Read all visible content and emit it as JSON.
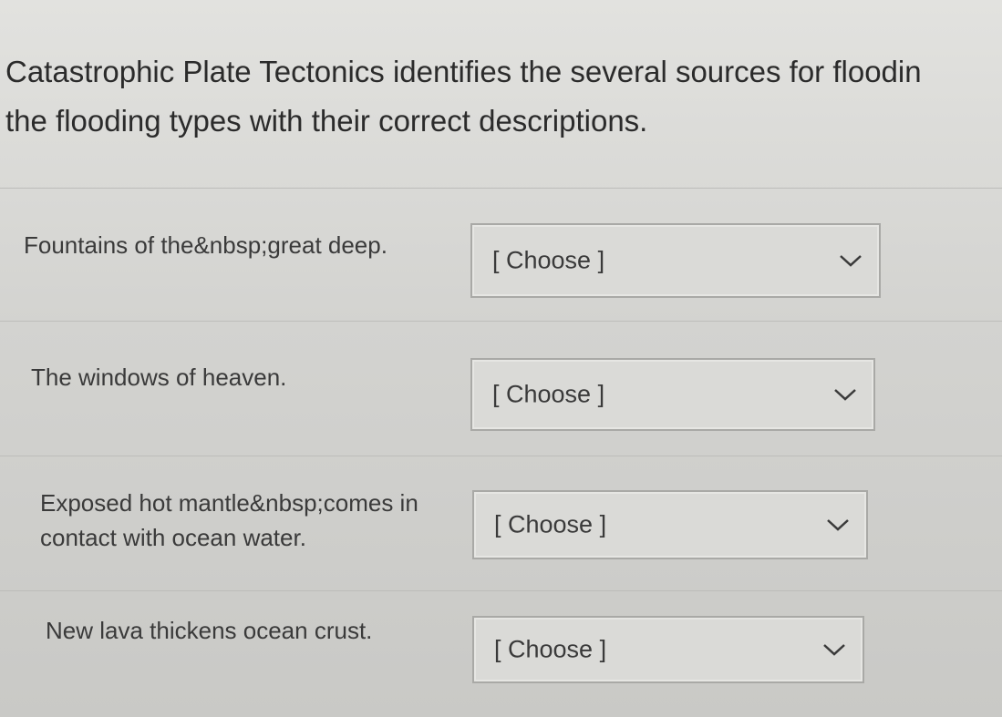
{
  "question": {
    "line1": "Catastrophic Plate Tectonics identifies the several sources for floodin",
    "line2": "the flooding types with their correct descriptions."
  },
  "matching": [
    {
      "prompt": "Fountains of the&nbsp;great deep.",
      "selected": "[ Choose ]"
    },
    {
      "prompt": "The windows of heaven.",
      "selected": "[ Choose ]"
    },
    {
      "prompt_line1": "Exposed hot mantle&nbsp;comes in",
      "prompt_line2": "contact with ocean water.",
      "selected": "[ Choose ]"
    },
    {
      "prompt": "New lava thickens ocean crust.",
      "selected": "[ Choose ]"
    }
  ],
  "icons": {
    "dropdown": "chevron-down-icon"
  }
}
